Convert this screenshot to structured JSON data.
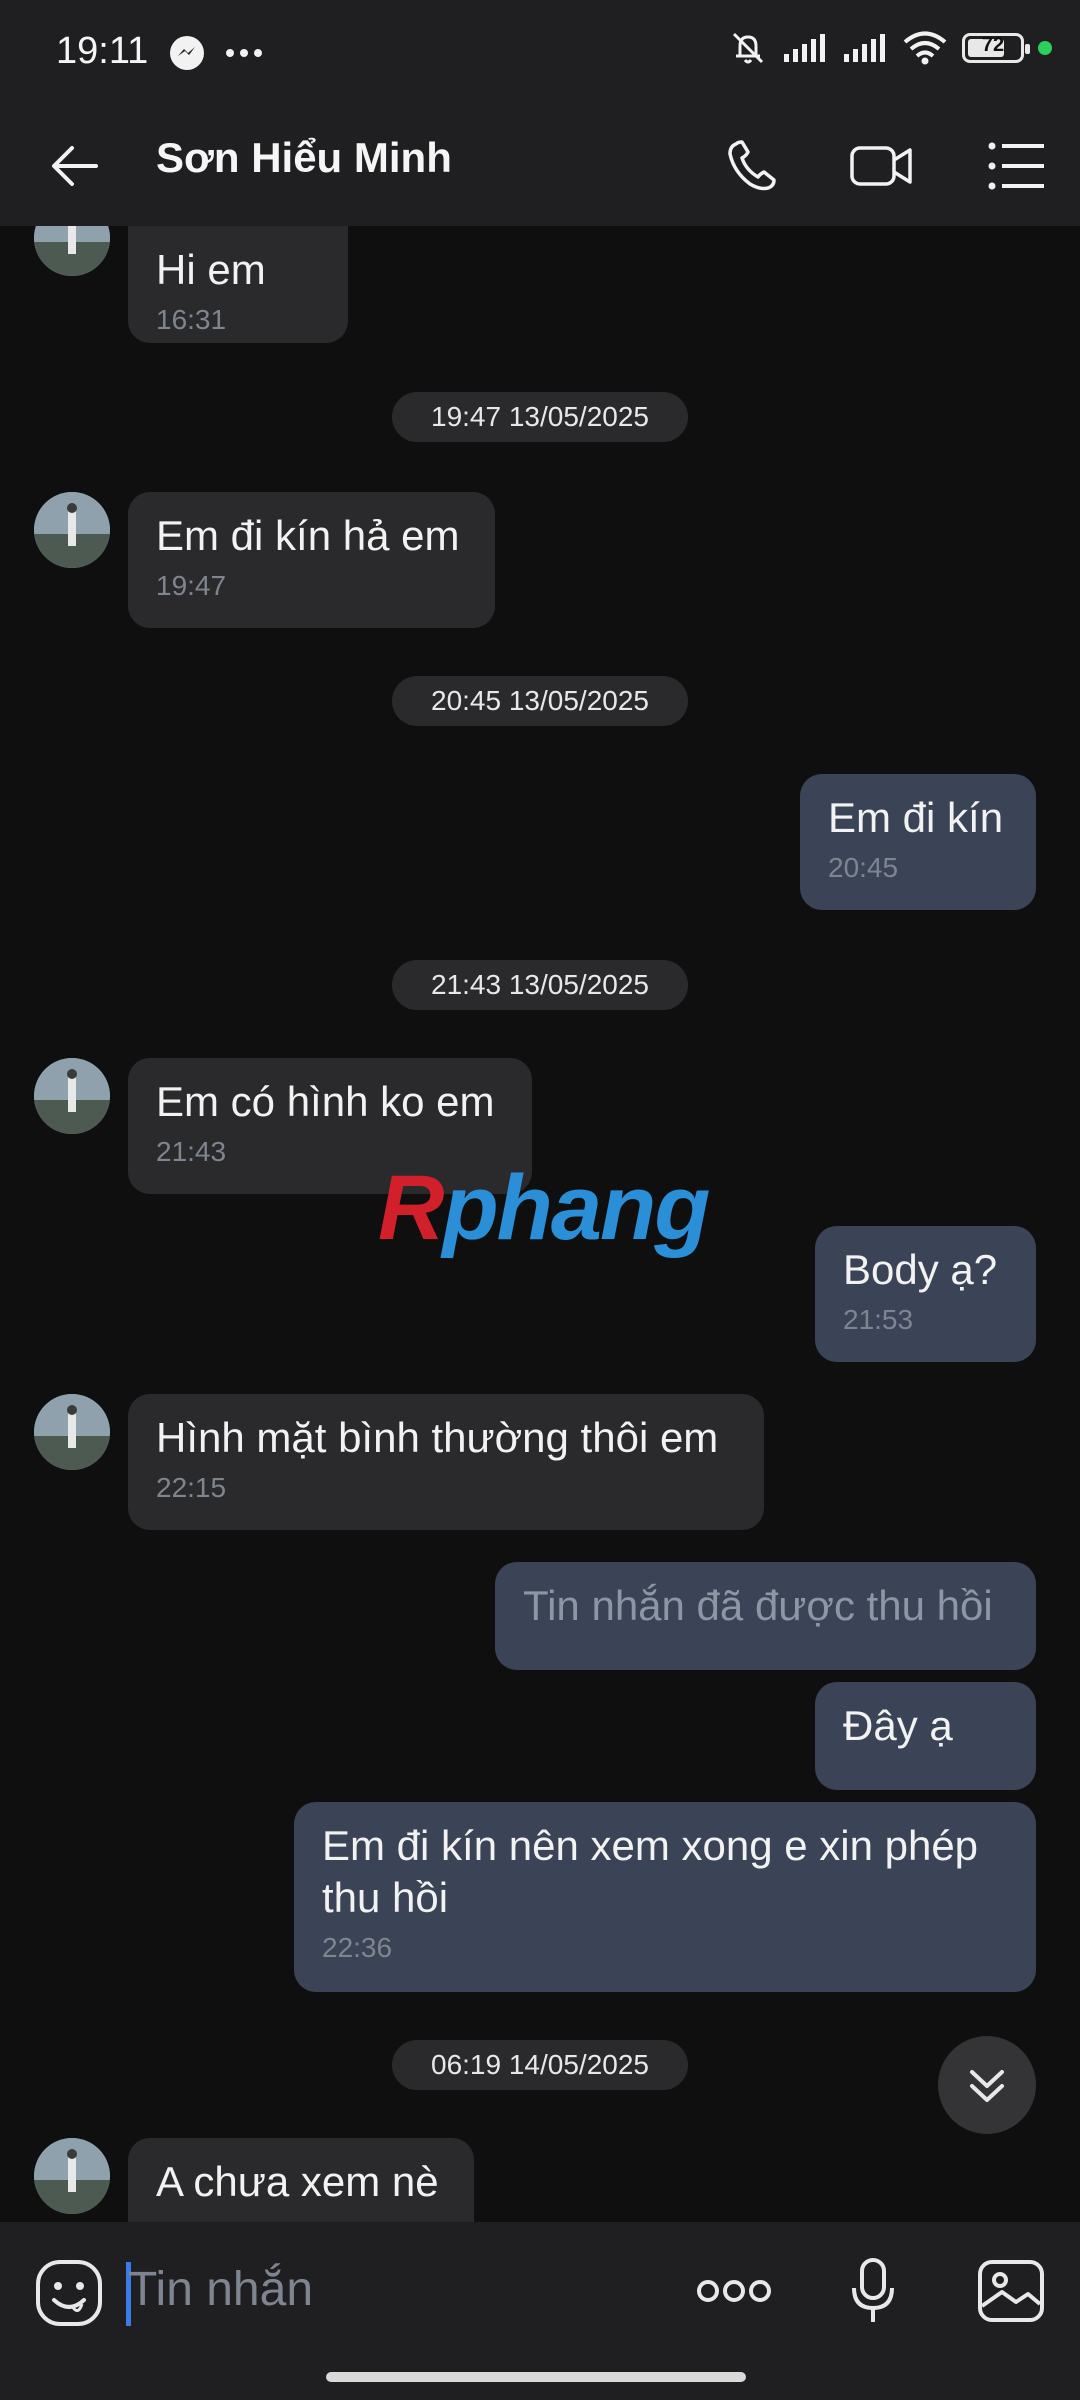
{
  "status_bar": {
    "time": "19:11",
    "battery": "72",
    "battery_level": 0.72
  },
  "header": {
    "title": "Sơn Hiểu Minh"
  },
  "messages": [
    {
      "side": "in",
      "text": "Hi em",
      "time": "16:31"
    },
    {
      "side": "date",
      "text": "19:47 13/05/2025"
    },
    {
      "side": "in",
      "text": "Em đi kín hả em",
      "time": "19:47"
    },
    {
      "side": "date",
      "text": "20:45 13/05/2025"
    },
    {
      "side": "out",
      "text": "Em đi kín",
      "time": "20:45"
    },
    {
      "side": "date",
      "text": "21:43 13/05/2025"
    },
    {
      "side": "in",
      "text": "Em có hình ko em",
      "time": "21:43"
    },
    {
      "side": "out",
      "text": "Body ạ?",
      "time": "21:53"
    },
    {
      "side": "in",
      "text": "Hình mặt bình thường thôi em",
      "time": "22:15"
    },
    {
      "side": "out",
      "text": "Tin nhắn đã được thu hồi",
      "recalled": true
    },
    {
      "side": "out",
      "text": "Đây ạ"
    },
    {
      "side": "out",
      "text": "Em đi kín nên xem xong e xin phép\nthu hồi",
      "time": "22:36"
    },
    {
      "side": "date",
      "text": "06:19 14/05/2025"
    },
    {
      "side": "in",
      "text": "A chưa xem nè"
    }
  ],
  "watermark": {
    "part1": "R",
    "part2": "phang"
  },
  "composer": {
    "placeholder": "Tin nhắn"
  },
  "colors": {
    "incoming_bubble": "#2a2a2c",
    "outgoing_bubble": "#3a4456",
    "accent": "#3a7bea"
  }
}
